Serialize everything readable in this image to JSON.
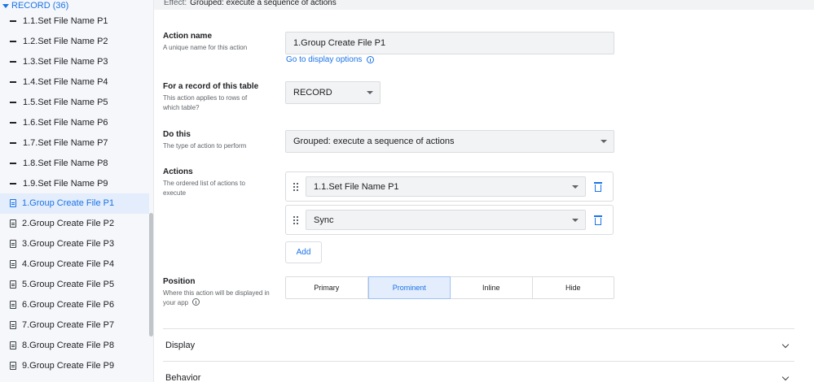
{
  "sidebar": {
    "header": "RECORD (36)",
    "items": [
      {
        "label": "1.1.Set File Name P1",
        "icon": "dash-icon"
      },
      {
        "label": "1.2.Set File Name P2",
        "icon": "dash-icon"
      },
      {
        "label": "1.3.Set File Name P3",
        "icon": "dash-icon"
      },
      {
        "label": "1.4.Set File Name P4",
        "icon": "dash-icon"
      },
      {
        "label": "1.5.Set File Name P5",
        "icon": "dash-icon"
      },
      {
        "label": "1.6.Set File Name P6",
        "icon": "dash-icon"
      },
      {
        "label": "1.7.Set File Name P7",
        "icon": "dash-icon"
      },
      {
        "label": "1.8.Set File Name P8",
        "icon": "dash-icon"
      },
      {
        "label": "1.9.Set File Name P9",
        "icon": "dash-icon"
      },
      {
        "label": "1.Group Create File P1",
        "icon": "document-icon",
        "selected": true
      },
      {
        "label": "2.Group Create File P2",
        "icon": "document-icon"
      },
      {
        "label": "3.Group Create File P3",
        "icon": "document-icon"
      },
      {
        "label": "4.Group Create File P4",
        "icon": "document-icon"
      },
      {
        "label": "5.Group Create File P5",
        "icon": "document-icon"
      },
      {
        "label": "6.Group Create File P6",
        "icon": "document-icon"
      },
      {
        "label": "7.Group Create File P7",
        "icon": "document-icon"
      },
      {
        "label": "8.Group Create File P8",
        "icon": "document-icon"
      },
      {
        "label": "9.Group Create File P9",
        "icon": "document-icon"
      }
    ]
  },
  "effect": {
    "label": "Effect:",
    "value": "Grouped: execute a sequence of actions"
  },
  "form": {
    "action_name": {
      "label": "Action name",
      "help": "A unique name for this action",
      "value": "1.Group Create File P1",
      "link": "Go to display options"
    },
    "table": {
      "label": "For a record of this table",
      "help": "This action applies to rows of which table?",
      "value": "RECORD"
    },
    "do_this": {
      "label": "Do this",
      "help": "The type of action to perform",
      "value": "Grouped: execute a sequence of actions"
    },
    "actions": {
      "label": "Actions",
      "help": "The ordered list of actions to execute",
      "items": [
        {
          "value": "1.1.Set File Name P1"
        },
        {
          "value": "Sync"
        }
      ],
      "add_label": "Add"
    },
    "position": {
      "label": "Position",
      "help": "Where this action will be displayed in your app",
      "options": [
        "Primary",
        "Prominent",
        "Inline",
        "Hide"
      ],
      "selected": "Prominent"
    }
  },
  "sections": [
    {
      "label": "Display"
    },
    {
      "label": "Behavior"
    }
  ],
  "colors": {
    "accent": "#1a73e8",
    "selected_bg": "#e3edfb"
  }
}
